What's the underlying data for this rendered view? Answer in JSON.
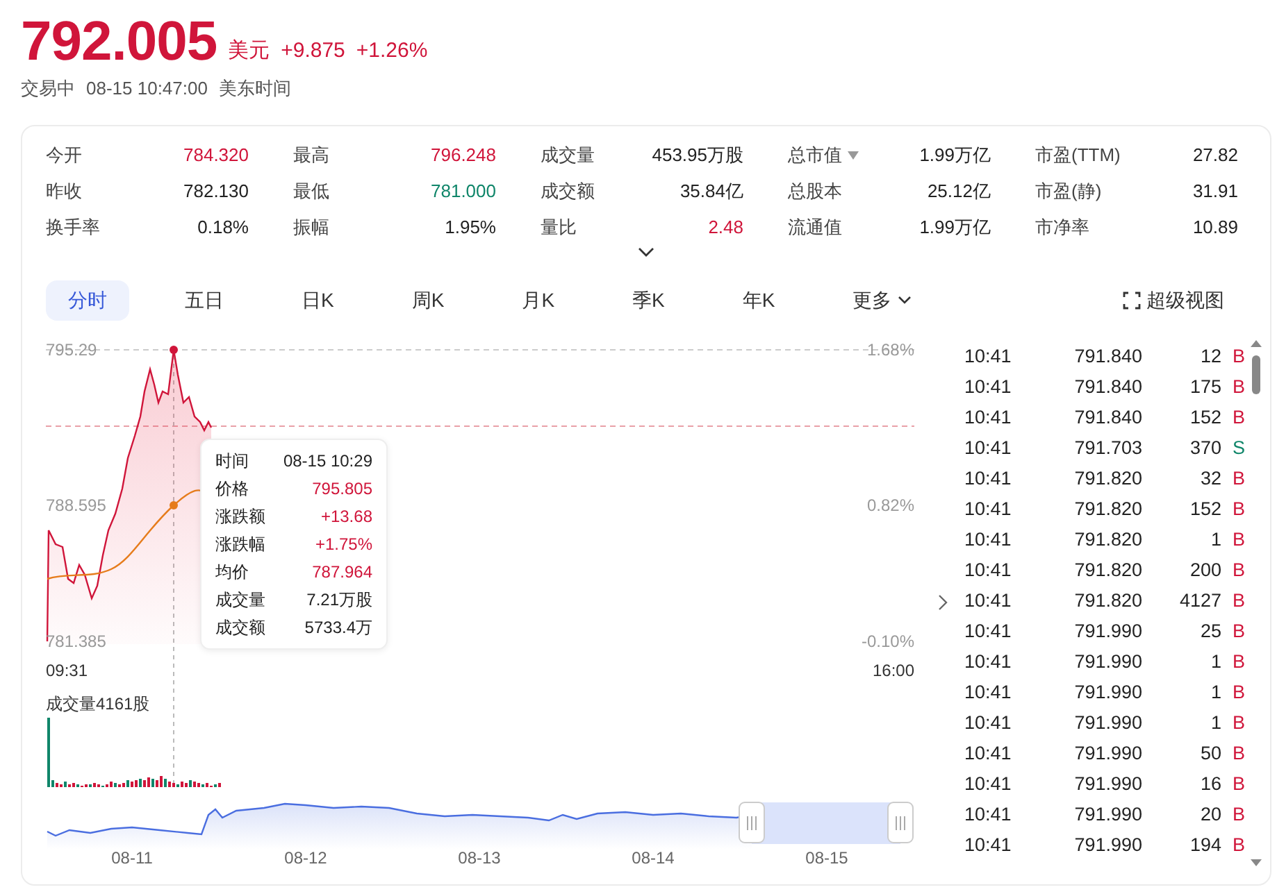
{
  "quote": {
    "price": "792.005",
    "currency": "美元",
    "change": "+9.875",
    "change_pct": "+1.26%",
    "status": "交易中",
    "datetime": "08-15 10:47:00",
    "timezone": "美东时间"
  },
  "stats": [
    {
      "label": "今开",
      "value": "784.320",
      "color": "#d0153a"
    },
    {
      "label": "最高",
      "value": "796.248",
      "color": "#d0153a"
    },
    {
      "label": "成交量",
      "value": "453.95万股",
      "color": "#222222"
    },
    {
      "label": "总市值",
      "value": "1.99万亿",
      "color": "#222222",
      "dropdown": true
    },
    {
      "label": "市盈(TTM)",
      "value": "27.82",
      "color": "#222222"
    },
    {
      "label": "昨收",
      "value": "782.130",
      "color": "#222222"
    },
    {
      "label": "最低",
      "value": "781.000",
      "color": "#10866a"
    },
    {
      "label": "成交额",
      "value": "35.84亿",
      "color": "#222222"
    },
    {
      "label": "总股本",
      "value": "25.12亿",
      "color": "#222222"
    },
    {
      "label": "市盈(静)",
      "value": "31.91",
      "color": "#222222"
    },
    {
      "label": "换手率",
      "value": "0.18%",
      "color": "#222222"
    },
    {
      "label": "振幅",
      "value": "1.95%",
      "color": "#222222"
    },
    {
      "label": "量比",
      "value": "2.48",
      "color": "#d0153a"
    },
    {
      "label": "流通值",
      "value": "1.99万亿",
      "color": "#222222"
    },
    {
      "label": "市净率",
      "value": "10.89",
      "color": "#222222"
    }
  ],
  "tabs": [
    {
      "label": "分时",
      "selected": true
    },
    {
      "label": "五日",
      "selected": false
    },
    {
      "label": "日K",
      "selected": false
    },
    {
      "label": "周K",
      "selected": false
    },
    {
      "label": "月K",
      "selected": false
    },
    {
      "label": "季K",
      "selected": false
    },
    {
      "label": "年K",
      "selected": false
    },
    {
      "label": "更多",
      "selected": false,
      "dropdown": true
    }
  ],
  "fullscreen_button": {
    "label": "超级视图"
  },
  "chart": {
    "price_labels": [
      "795.29",
      "788.595",
      "781.385"
    ],
    "pct_labels": [
      "1.68%",
      "0.82%",
      "-0.10%"
    ],
    "time_start": "09:31",
    "time_end": "16:00",
    "volume_label": "成交量4161股",
    "navigator_dates": [
      "08-11",
      "08-12",
      "08-13",
      "08-14",
      "08-15"
    ]
  },
  "tooltip": {
    "rows": [
      {
        "label": "时间",
        "value": "08-15 10:29",
        "color": "#222222"
      },
      {
        "label": "价格",
        "value": "795.805",
        "color": "#d0153a"
      },
      {
        "label": "涨跌额",
        "value": "+13.68",
        "color": "#d0153a"
      },
      {
        "label": "涨跌幅",
        "value": "+1.75%",
        "color": "#d0153a"
      },
      {
        "label": "均价",
        "value": "787.964",
        "color": "#d0153a"
      },
      {
        "label": "成交量",
        "value": "7.21万股",
        "color": "#222222"
      },
      {
        "label": "成交额",
        "value": "5733.4万",
        "color": "#222222"
      }
    ]
  },
  "trades": [
    {
      "time": "10:41",
      "price": "791.840",
      "volume": "12",
      "side": "B",
      "color": "#d0153a"
    },
    {
      "time": "10:41",
      "price": "791.840",
      "volume": "175",
      "side": "B",
      "color": "#d0153a"
    },
    {
      "time": "10:41",
      "price": "791.840",
      "volume": "152",
      "side": "B",
      "color": "#d0153a"
    },
    {
      "time": "10:41",
      "price": "791.703",
      "volume": "370",
      "side": "S",
      "color": "#10866a"
    },
    {
      "time": "10:41",
      "price": "791.820",
      "volume": "32",
      "side": "B",
      "color": "#d0153a"
    },
    {
      "time": "10:41",
      "price": "791.820",
      "volume": "152",
      "side": "B",
      "color": "#d0153a"
    },
    {
      "time": "10:41",
      "price": "791.820",
      "volume": "1",
      "side": "B",
      "color": "#d0153a"
    },
    {
      "time": "10:41",
      "price": "791.820",
      "volume": "200",
      "side": "B",
      "color": "#d0153a"
    },
    {
      "time": "10:41",
      "price": "791.820",
      "volume": "4127",
      "side": "B",
      "color": "#d0153a"
    },
    {
      "time": "10:41",
      "price": "791.990",
      "volume": "25",
      "side": "B",
      "color": "#d0153a"
    },
    {
      "time": "10:41",
      "price": "791.990",
      "volume": "1",
      "side": "B",
      "color": "#d0153a"
    },
    {
      "time": "10:41",
      "price": "791.990",
      "volume": "1",
      "side": "B",
      "color": "#d0153a"
    },
    {
      "time": "10:41",
      "price": "791.990",
      "volume": "1",
      "side": "B",
      "color": "#d0153a"
    },
    {
      "time": "10:41",
      "price": "791.990",
      "volume": "50",
      "side": "B",
      "color": "#d0153a"
    },
    {
      "time": "10:41",
      "price": "791.990",
      "volume": "16",
      "side": "B",
      "color": "#d0153a"
    },
    {
      "time": "10:41",
      "price": "791.990",
      "volume": "20",
      "side": "B",
      "color": "#d0153a"
    },
    {
      "time": "10:41",
      "price": "791.990",
      "volume": "194",
      "side": "B",
      "color": "#d0153a"
    }
  ]
}
